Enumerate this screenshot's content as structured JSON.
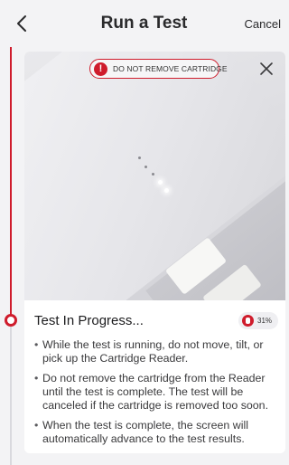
{
  "header": {
    "title": "Run a Test",
    "cancel_label": "Cancel"
  },
  "banner": {
    "warning_text": "DO NOT REMOVE CARTRIDGE",
    "warning_icon": "!"
  },
  "status": {
    "title": "Test In Progress...",
    "progress_text": "31%",
    "progress": 0.31
  },
  "instructions": [
    "While the test is running, do not move, tilt, or pick up the Cartridge Reader.",
    "Do not remove the cartridge from the Reader until the test is complete. The test will be canceled if the cartridge is removed too soon.",
    "When the test is complete, the screen will automatically advance to the test results."
  ],
  "colors": {
    "accent": "#cf1c2c",
    "background": "#f3f3f5",
    "card": "#ffffff"
  },
  "icons": [
    "back-chevron-icon",
    "warning-icon",
    "close-icon",
    "cartridge-progress-icon"
  ]
}
